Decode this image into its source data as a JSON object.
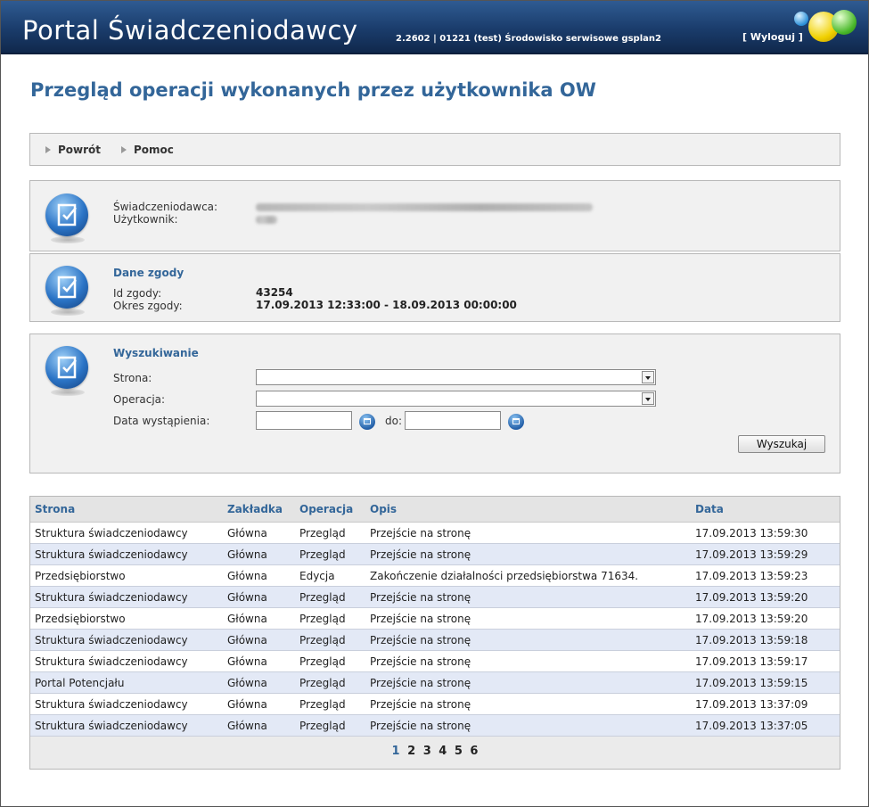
{
  "header": {
    "title": "Portal Świadczeniodawcy",
    "version": "2.2602 | 01221 (test) Środowisko serwisowe gsplan2",
    "logout": "[ Wyloguj ]"
  },
  "page": {
    "title": "Przegląd operacji wykonanych przez użytkownika OW"
  },
  "toolbar": {
    "back": "Powrót",
    "help": "Pomoc"
  },
  "info": {
    "provider_label": "Świadczeniodawca:",
    "user_label": "Użytkownik:"
  },
  "consent": {
    "title": "Dane zgody",
    "id_label": "Id zgody:",
    "id_value": "43254",
    "period_label": "Okres zgody:",
    "period_value": "17.09.2013 12:33:00 - 18.09.2013 00:00:00"
  },
  "search": {
    "title": "Wyszukiwanie",
    "page_label": "Strona:",
    "page_value": "",
    "operation_label": "Operacja:",
    "operation_value": "",
    "date_label": "Data wystąpienia:",
    "date_from": "",
    "date_to_label": "do:",
    "date_to": "",
    "button": "Wyszukaj"
  },
  "table": {
    "columns": [
      "Strona",
      "Zakładka",
      "Operacja",
      "Opis",
      "Data"
    ],
    "rows": [
      [
        "Struktura świadczeniodawcy",
        "Główna",
        "Przegląd",
        "Przejście na stronę",
        "17.09.2013 13:59:30"
      ],
      [
        "Struktura świadczeniodawcy",
        "Główna",
        "Przegląd",
        "Przejście na stronę",
        "17.09.2013 13:59:29"
      ],
      [
        "Przedsiębiorstwo",
        "Główna",
        "Edycja",
        "Zakończenie działalności przedsiębiorstwa 71634.",
        "17.09.2013 13:59:23"
      ],
      [
        "Struktura świadczeniodawcy",
        "Główna",
        "Przegląd",
        "Przejście na stronę",
        "17.09.2013 13:59:20"
      ],
      [
        "Przedsiębiorstwo",
        "Główna",
        "Przegląd",
        "Przejście na stronę",
        "17.09.2013 13:59:20"
      ],
      [
        "Struktura świadczeniodawcy",
        "Główna",
        "Przegląd",
        "Przejście na stronę",
        "17.09.2013 13:59:18"
      ],
      [
        "Struktura świadczeniodawcy",
        "Główna",
        "Przegląd",
        "Przejście na stronę",
        "17.09.2013 13:59:17"
      ],
      [
        "Portal Potencjału",
        "Główna",
        "Przegląd",
        "Przejście na stronę",
        "17.09.2013 13:59:15"
      ],
      [
        "Struktura świadczeniodawcy",
        "Główna",
        "Przegląd",
        "Przejście na stronę",
        "17.09.2013 13:37:09"
      ],
      [
        "Struktura świadczeniodawcy",
        "Główna",
        "Przegląd",
        "Przejście na stronę",
        "17.09.2013 13:37:05"
      ]
    ]
  },
  "pagination": {
    "pages": [
      "1",
      "2",
      "3",
      "4",
      "5",
      "6"
    ],
    "current": "1"
  },
  "colors": {
    "header_bg": "#1a3c6b",
    "accent": "#336699",
    "row_alt": "#e3e9f6"
  },
  "icons": [
    "document-check-icon",
    "calendar-icon",
    "dropdown-arrow-icon",
    "triangle-bullet-icon"
  ]
}
